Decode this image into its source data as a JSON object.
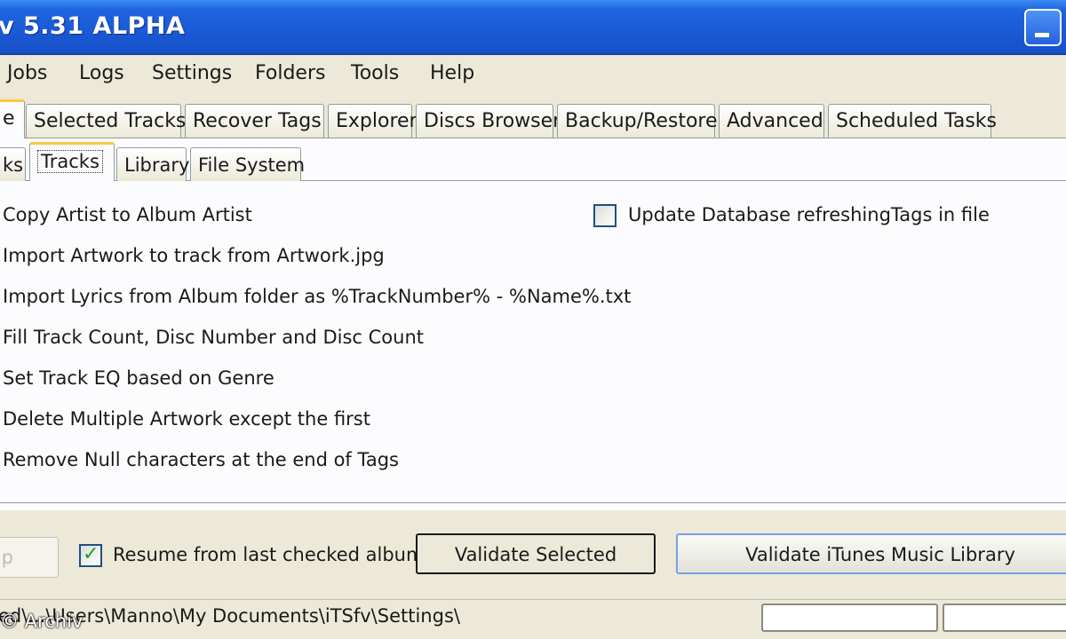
{
  "window": {
    "title": "v 5.31 ALPHA"
  },
  "menu": [
    {
      "label": "Jobs"
    },
    {
      "label": "Logs"
    },
    {
      "label": "Settings"
    },
    {
      "label": "Folders"
    },
    {
      "label": "Tools"
    },
    {
      "label": "Help"
    }
  ],
  "main_tabs": [
    "e",
    "Selected Tracks",
    "Recover Tags",
    "Explorer",
    "Discs Browser",
    "Backup/Restore",
    "Advanced",
    "Scheduled Tasks"
  ],
  "sub_tabs": [
    "ks",
    "Tracks",
    "Library",
    "File System"
  ],
  "options": [
    "Copy Artist to Album Artist",
    "Import Artwork to track from Artwork.jpg",
    "Import Lyrics from Album folder as %TrackNumber% - %Name%.txt",
    "Fill Track Count, Disc Number and Disc Count",
    "Set Track EQ based on Genre",
    "Delete Multiple Artwork except the first",
    "Remove Null characters at the end of Tags"
  ],
  "update_db": {
    "label": "Update Database refreshingTags in file",
    "checked": false
  },
  "resume": {
    "label": "Resume from last checked album",
    "checked": true
  },
  "buttons": {
    "stop": "p",
    "validate_selected": "Validate Selected",
    "validate_library": "Validate iTunes Music Library"
  },
  "status": {
    "path": "ed\\...\\Users\\Manno\\My Documents\\iTSfv\\Settings\\",
    "watermark": "© Archiv"
  }
}
